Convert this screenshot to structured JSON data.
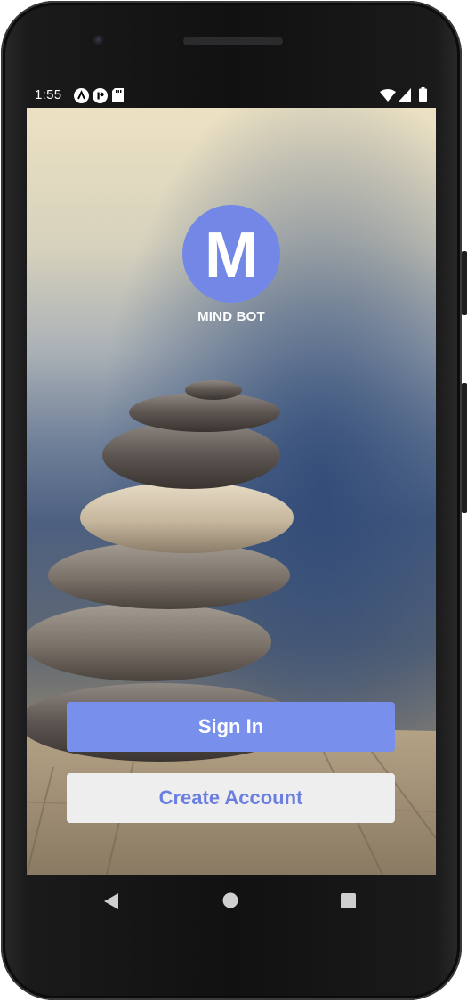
{
  "status_bar": {
    "time": "1:55",
    "icons": [
      "notification-a-icon",
      "notification-r-icon",
      "sd-card-icon",
      "wifi-icon",
      "cellular-signal-icon",
      "battery-icon"
    ]
  },
  "app": {
    "logo_letter": "M",
    "logo_name": "MIND BOT",
    "background_image": "stacked-stones-photo",
    "sign_in_label": "Sign In",
    "create_account_label": "Create Account"
  },
  "nav_bar": {
    "icons": [
      "back-icon",
      "home-icon",
      "recents-icon"
    ]
  },
  "colors": {
    "accent": "#7890ec",
    "logo_circle": "#7388e6",
    "create_button_bg": "#eeeeee",
    "create_button_text": "#6a7fe0"
  }
}
